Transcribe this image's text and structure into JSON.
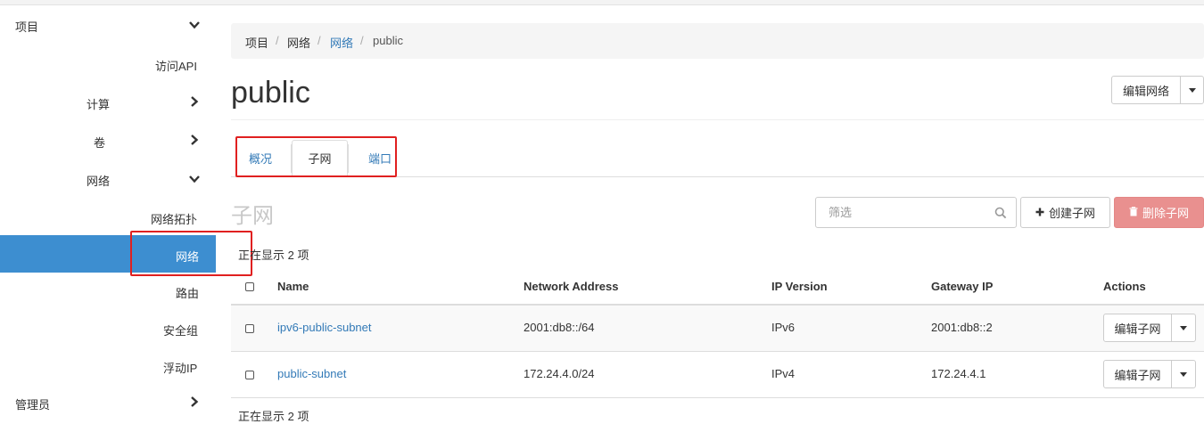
{
  "sidebar": {
    "items": [
      {
        "label": "项目",
        "chevron": "down"
      },
      {
        "label": "访问API",
        "chevron": null
      },
      {
        "label": "计算",
        "chevron": "right"
      },
      {
        "label": "卷",
        "chevron": "right"
      },
      {
        "label": "网络",
        "chevron": "down"
      },
      {
        "label": "网络拓扑",
        "chevron": null
      },
      {
        "label": "网络",
        "chevron": null,
        "active": true
      },
      {
        "label": "路由",
        "chevron": null
      },
      {
        "label": "安全组",
        "chevron": null
      },
      {
        "label": "浮动IP",
        "chevron": null
      },
      {
        "label": "管理员",
        "chevron": "right"
      }
    ]
  },
  "breadcrumb": {
    "items": [
      "项目",
      "网络",
      "网络",
      "public"
    ],
    "separator": "/"
  },
  "page": {
    "title": "public",
    "edit_network_button": "编辑网络"
  },
  "tabs": [
    {
      "label": "概况",
      "active": false
    },
    {
      "label": "子网",
      "active": true
    },
    {
      "label": "端口",
      "active": false
    }
  ],
  "subnets": {
    "section_title": "子网",
    "filter_placeholder": "筛选",
    "create_button": "创建子网",
    "delete_button": "删除子网",
    "count_text": "正在显示 2 项",
    "columns": [
      "Name",
      "Network Address",
      "IP Version",
      "Gateway IP",
      "Actions"
    ],
    "rows": [
      {
        "name": "ipv6-public-subnet",
        "network_address": "2001:db8::/64",
        "ip_version": "IPv6",
        "gateway_ip": "2001:db8::2",
        "action": "编辑子网"
      },
      {
        "name": "public-subnet",
        "network_address": "172.24.4.0/24",
        "ip_version": "IPv4",
        "gateway_ip": "172.24.4.1",
        "action": "编辑子网"
      }
    ],
    "footer_count_text": "正在显示 2 项"
  },
  "colors": {
    "active_nav": "#3d8ed0",
    "link": "#337ab7",
    "danger_button": "#e9908f",
    "annotation": "#e02020"
  },
  "icons": {
    "search": "search-icon",
    "plus": "plus-icon",
    "trash": "trash-icon",
    "chevron_down": "chevron-down-icon",
    "chevron_right": "chevron-right-icon"
  }
}
